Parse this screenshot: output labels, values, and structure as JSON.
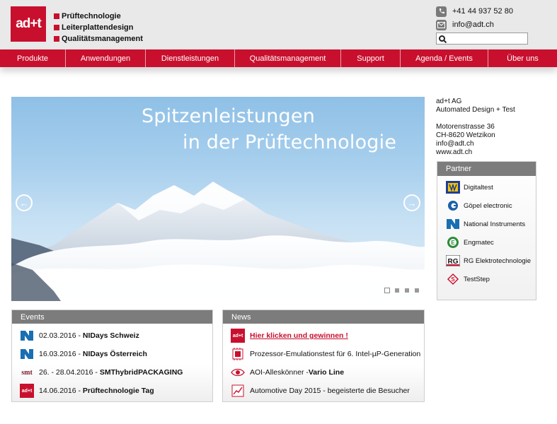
{
  "header": {
    "logo_text": "ad+t",
    "taglines": [
      "Prüftechnologie",
      "Leiterplattendesign",
      "Qualitätsmanagement"
    ],
    "phone": "+41 44 937 52 80",
    "email": "info@adt.ch",
    "search_placeholder": ""
  },
  "nav": {
    "items": [
      "Produkte",
      "Anwendungen",
      "Dienstleistungen",
      "Qualitätsmanagement",
      "Support",
      "Agenda / Events",
      "Über uns"
    ]
  },
  "hero": {
    "line1": "Spitzenleistungen",
    "line2": "in der Prüftechnologie",
    "prev_icon": "chevron-left-icon",
    "next_icon": "chevron-right-icon",
    "slides": 4,
    "active_slide": 1
  },
  "address": {
    "company": "ad+t AG",
    "subtitle": "Automated Design + Test",
    "street": "Motorenstrasse 36",
    "city": "CH-8620 Wetzikon",
    "email": "info@adt.ch",
    "web": "www.adt.ch"
  },
  "partner": {
    "title": "Partner",
    "items": [
      {
        "name": "Digitaltest",
        "icon": "digitaltest-logo"
      },
      {
        "name": "Göpel electronic",
        "icon": "goepel-logo"
      },
      {
        "name": "National Instruments",
        "icon": "national-instruments-logo"
      },
      {
        "name": "Engmatec",
        "icon": "engmatec-logo"
      },
      {
        "name": "RG Elektrotechnologie",
        "icon": "rg-logo"
      },
      {
        "name": "TestStep",
        "icon": "teststep-logo"
      }
    ]
  },
  "events": {
    "title": "Events",
    "items": [
      {
        "date": "02.03.2016 - ",
        "name": "NIDays Schweiz",
        "icon": "national-instruments-logo"
      },
      {
        "date": "16.03.2016 - ",
        "name": "NIDays Österreich",
        "icon": "national-instruments-logo"
      },
      {
        "date": "26. - 28.04.2016 - ",
        "name": "SMThybridPACKAGING",
        "icon": "smt-logo"
      },
      {
        "date": "14.06.2016 - ",
        "name": "Prüftechnologie Tag",
        "icon": "adt-logo"
      }
    ]
  },
  "news": {
    "title": "News",
    "items": [
      {
        "text": "Hier klicken und gewinnen !",
        "icon": "adt-logo"
      },
      {
        "text": "Prozessor-Emulationstest für 6. Intel-µP-Generation",
        "icon": "processor-icon"
      },
      {
        "text": "AOI-Alleskönner - ",
        "bold": "Vario Line",
        "icon": "eye-icon"
      },
      {
        "text": "Automotive Day 2015 - begeisterte die Besucher",
        "icon": "chart-icon"
      }
    ]
  },
  "colors": {
    "brand_red": "#c8102e",
    "panel_grey": "#7c7c7c"
  }
}
